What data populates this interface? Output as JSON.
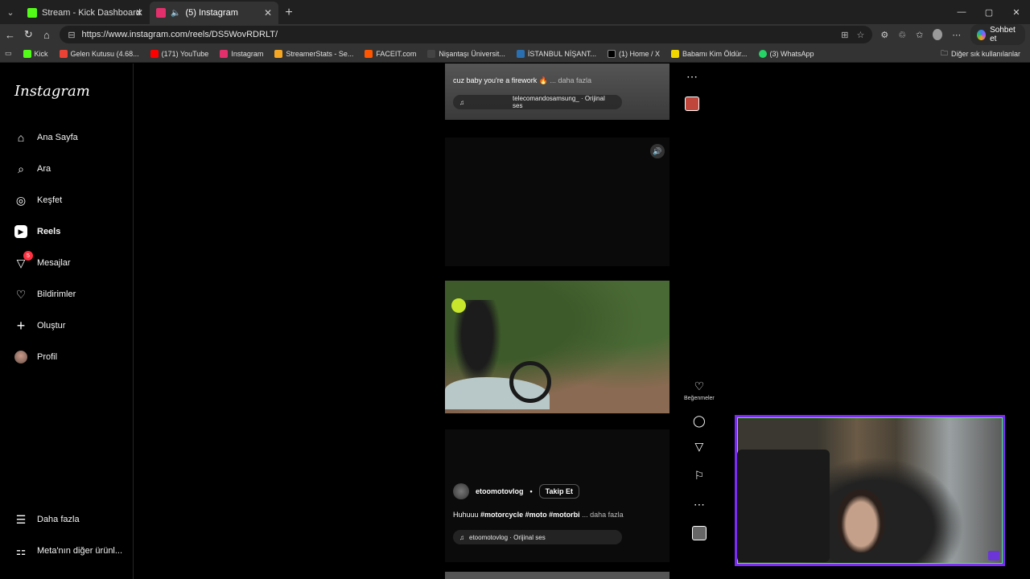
{
  "browser": {
    "tabs": [
      {
        "label": "Stream - Kick Dashboard",
        "fav_color": "#53fc18",
        "active": false
      },
      {
        "label": "(5) Instagram",
        "fav_color": "#e1306c",
        "active": true
      }
    ],
    "url": "https://www.instagram.com/reels/DS5WovRDRLT/",
    "copilot_label": "Sohbet et",
    "bookmarks": [
      {
        "label": "Kick",
        "color": "#53fc18"
      },
      {
        "label": "Gelen Kutusu (4.68...",
        "color": "#ea4335"
      },
      {
        "label": "(171) YouTube",
        "color": "#ff0000"
      },
      {
        "label": "Instagram",
        "color": "#e1306c"
      },
      {
        "label": "StreamerStats - Se...",
        "color": "#f5a623"
      },
      {
        "label": "FACEIT.com",
        "color": "#ff5500"
      },
      {
        "label": "Nişantaşı Üniversit...",
        "color": "#444444"
      },
      {
        "label": "İSTANBUL NİŞANT...",
        "color": "#2a6fb0"
      },
      {
        "label": "(1) Home / X",
        "color": "#000000"
      },
      {
        "label": "Babamı Kim Öldür...",
        "color": "#f2d600"
      },
      {
        "label": "(3) WhatsApp",
        "color": "#25d366"
      }
    ],
    "other_bookmarks": "Diğer sık kullanılanlar"
  },
  "instagram": {
    "logo": "Instagram",
    "nav": [
      {
        "label": "Ana Sayfa",
        "icon": "home-icon",
        "glyph": "⌂"
      },
      {
        "label": "Ara",
        "icon": "search-icon",
        "glyph": "⌕"
      },
      {
        "label": "Keşfet",
        "icon": "compass-icon",
        "glyph": "◎"
      },
      {
        "label": "Reels",
        "icon": "reels-icon",
        "glyph": "▶"
      },
      {
        "label": "Mesajlar",
        "icon": "messenger-icon",
        "glyph": "▽",
        "badge": "5"
      },
      {
        "label": "Bildirimler",
        "icon": "heart-icon",
        "glyph": "♡"
      },
      {
        "label": "Oluştur",
        "icon": "plus-icon",
        "glyph": "+"
      },
      {
        "label": "Profil",
        "icon": "profile-avatar",
        "glyph": ""
      }
    ],
    "more": "Daha fazla",
    "meta": "Meta'nın diğer ürünl..."
  },
  "reels": {
    "top": {
      "caption": "cuz baby you're a firework 🔥",
      "more": "... daha fazla",
      "audio": "telecomandosamsung_ · Orijinal ses"
    },
    "current": {
      "likes_label": "Beğenmeler",
      "username": "etoomotovlog",
      "follow": "Takip Et",
      "caption_text": "Huhuuu",
      "hashtags": "#motorcycle #moto #motorbi",
      "more": "... daha fazla",
      "audio": "etoomotovlog · Orijinal ses"
    }
  }
}
